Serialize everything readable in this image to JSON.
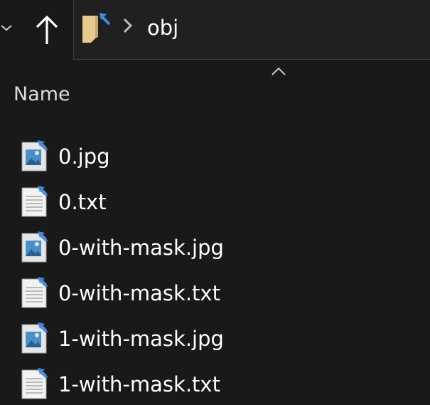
{
  "nav": {
    "back_dropdown_icon": "chevron-down-icon",
    "up_icon": "arrow-up-icon"
  },
  "address_bar": {
    "folder_icon": "folder-shortcut-icon",
    "separator_icon": "chevron-right-icon",
    "path": "obj"
  },
  "column_header": {
    "label": "Name",
    "sort_icon": "sort-ascending-caret-icon"
  },
  "files": [
    {
      "name": "0.jpg",
      "type": "image"
    },
    {
      "name": "0.txt",
      "type": "text"
    },
    {
      "name": "0-with-mask.jpg",
      "type": "image"
    },
    {
      "name": "0-with-mask.txt",
      "type": "text"
    },
    {
      "name": "1-with-mask.jpg",
      "type": "image"
    },
    {
      "name": "1-with-mask.txt",
      "type": "text"
    }
  ],
  "colors": {
    "background": "#191919",
    "address_bar": "#202020",
    "shortcut_arrow": "#3a8ee6",
    "image_icon_blue": "#4a90c8"
  }
}
